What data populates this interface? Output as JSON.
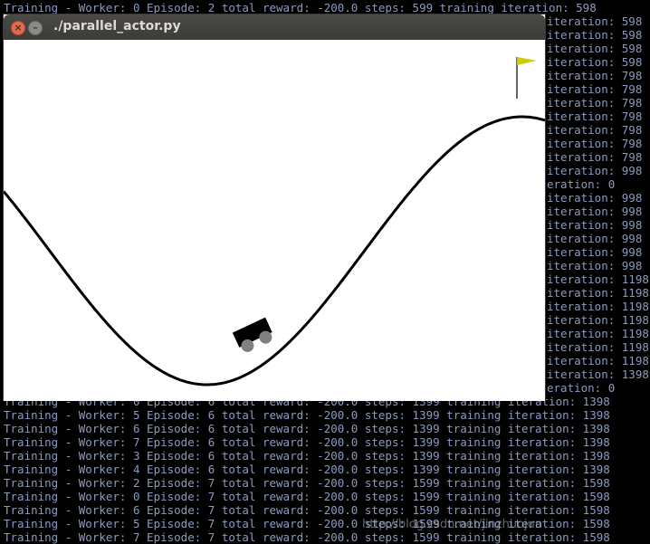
{
  "window": {
    "title": "./parallel_actor.py",
    "close_glyph": "×",
    "minimize_glyph": "–"
  },
  "terminal": {
    "watermark": "http://blog.csdn.net/jinzhuojun",
    "top_line": "Training - Worker: 0 Episode: 2 total reward: -200.0 steps: 599 training iteration: 598",
    "right_lines": [
      "iteration: 598",
      "iteration: 598",
      "iteration: 598",
      "iteration: 598",
      "iteration: 798",
      "iteration: 798",
      "iteration: 798",
      "iteration: 798",
      "iteration: 798",
      "iteration: 798",
      "iteration: 798",
      "iteration: 998",
      "eration: 0",
      "iteration: 998",
      "iteration: 998",
      "iteration: 998",
      "iteration: 998",
      "iteration: 998",
      "iteration: 998",
      "iteration: 1198",
      "iteration: 1198",
      "iteration: 1198",
      "iteration: 1198",
      "iteration: 1198",
      "iteration: 1198",
      "iteration: 1198",
      "iteration: 1398",
      "eration: 0"
    ],
    "bottom_lines": [
      "Training - Worker: 0 Episode: 6 total reward: -200.0 steps: 1399 training iteration: 1398",
      "Training - Worker: 5 Episode: 6 total reward: -200.0 steps: 1399 training iteration: 1398",
      "Training - Worker: 6 Episode: 6 total reward: -200.0 steps: 1399 training iteration: 1398",
      "Training - Worker: 7 Episode: 6 total reward: -200.0 steps: 1399 training iteration: 1398",
      "Training - Worker: 3 Episode: 6 total reward: -200.0 steps: 1399 training iteration: 1398",
      "Training - Worker: 4 Episode: 6 total reward: -200.0 steps: 1399 training iteration: 1398",
      "Training - Worker: 2 Episode: 7 total reward: -200.0 steps: 1599 training iteration: 1598",
      "Training - Worker: 0 Episode: 7 total reward: -200.0 steps: 1599 training iteration: 1598",
      "Training - Worker: 6 Episode: 7 total reward: -200.0 steps: 1599 training iteration: 1598",
      "Training - Worker: 5 Episode: 7 total reward: -200.0 steps: 1599 training iteration: 1598",
      "Training - Worker: 7 Episode: 7 total reward: -200.0 steps: 1599 training iteration: 1598"
    ]
  },
  "scene": {
    "curve_color": "#000000",
    "car_color": "#000000",
    "wheel_color": "#808080",
    "flag_color": "#cccc00",
    "pole_color": "#000000"
  }
}
